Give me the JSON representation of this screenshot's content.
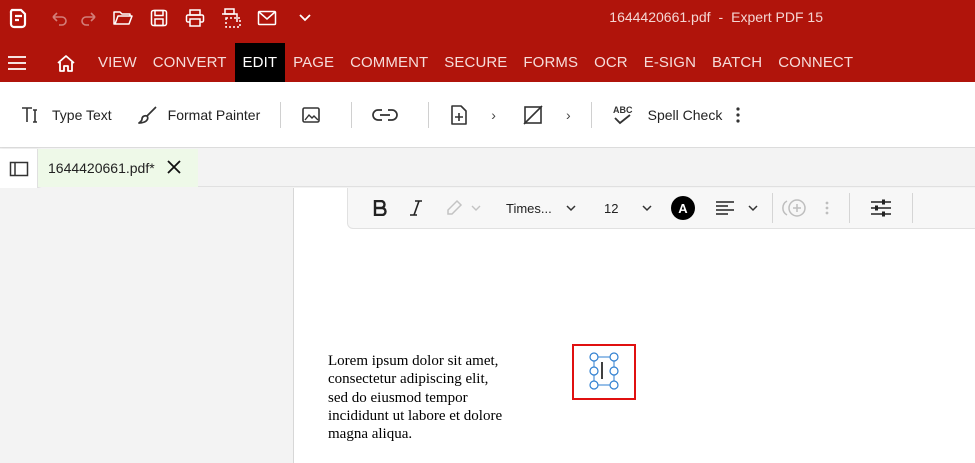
{
  "window": {
    "file_name": "1644420661.pdf",
    "separator": "-",
    "app_name": "Expert PDF 15"
  },
  "quick_access": [
    {
      "name": "app-logo-icon"
    },
    {
      "name": "undo-icon"
    },
    {
      "name": "redo-icon"
    },
    {
      "name": "open-folder-icon"
    },
    {
      "name": "save-icon"
    },
    {
      "name": "print-icon"
    },
    {
      "name": "scan-icon"
    },
    {
      "name": "email-icon"
    },
    {
      "name": "customize-chevron-icon"
    }
  ],
  "menu": {
    "items": [
      "VIEW",
      "CONVERT",
      "EDIT",
      "PAGE",
      "COMMENT",
      "SECURE",
      "FORMS",
      "OCR",
      "E-SIGN",
      "BATCH",
      "CONNECT"
    ],
    "active": "EDIT"
  },
  "toolbar": {
    "type_text": "Type Text",
    "format_painter": "Format Painter",
    "spell_check": "Spell Check"
  },
  "document_tab": {
    "label": "1644420661.pdf*"
  },
  "format_bar": {
    "font": "Times...",
    "size": "12",
    "font_color_letter": "A"
  },
  "page_content": {
    "lines": [
      "Lorem ipsum dolor sit amet,",
      "consectetur adipiscing elit,",
      "sed do eiusmod tempor",
      "incididunt ut labore et dolore",
      "magna aliqua."
    ]
  },
  "colors": {
    "brand_red": "#b0140b",
    "selection_red": "#e01010",
    "tab_green": "#eef9e8",
    "handle_blue": "#2f7fd0"
  }
}
